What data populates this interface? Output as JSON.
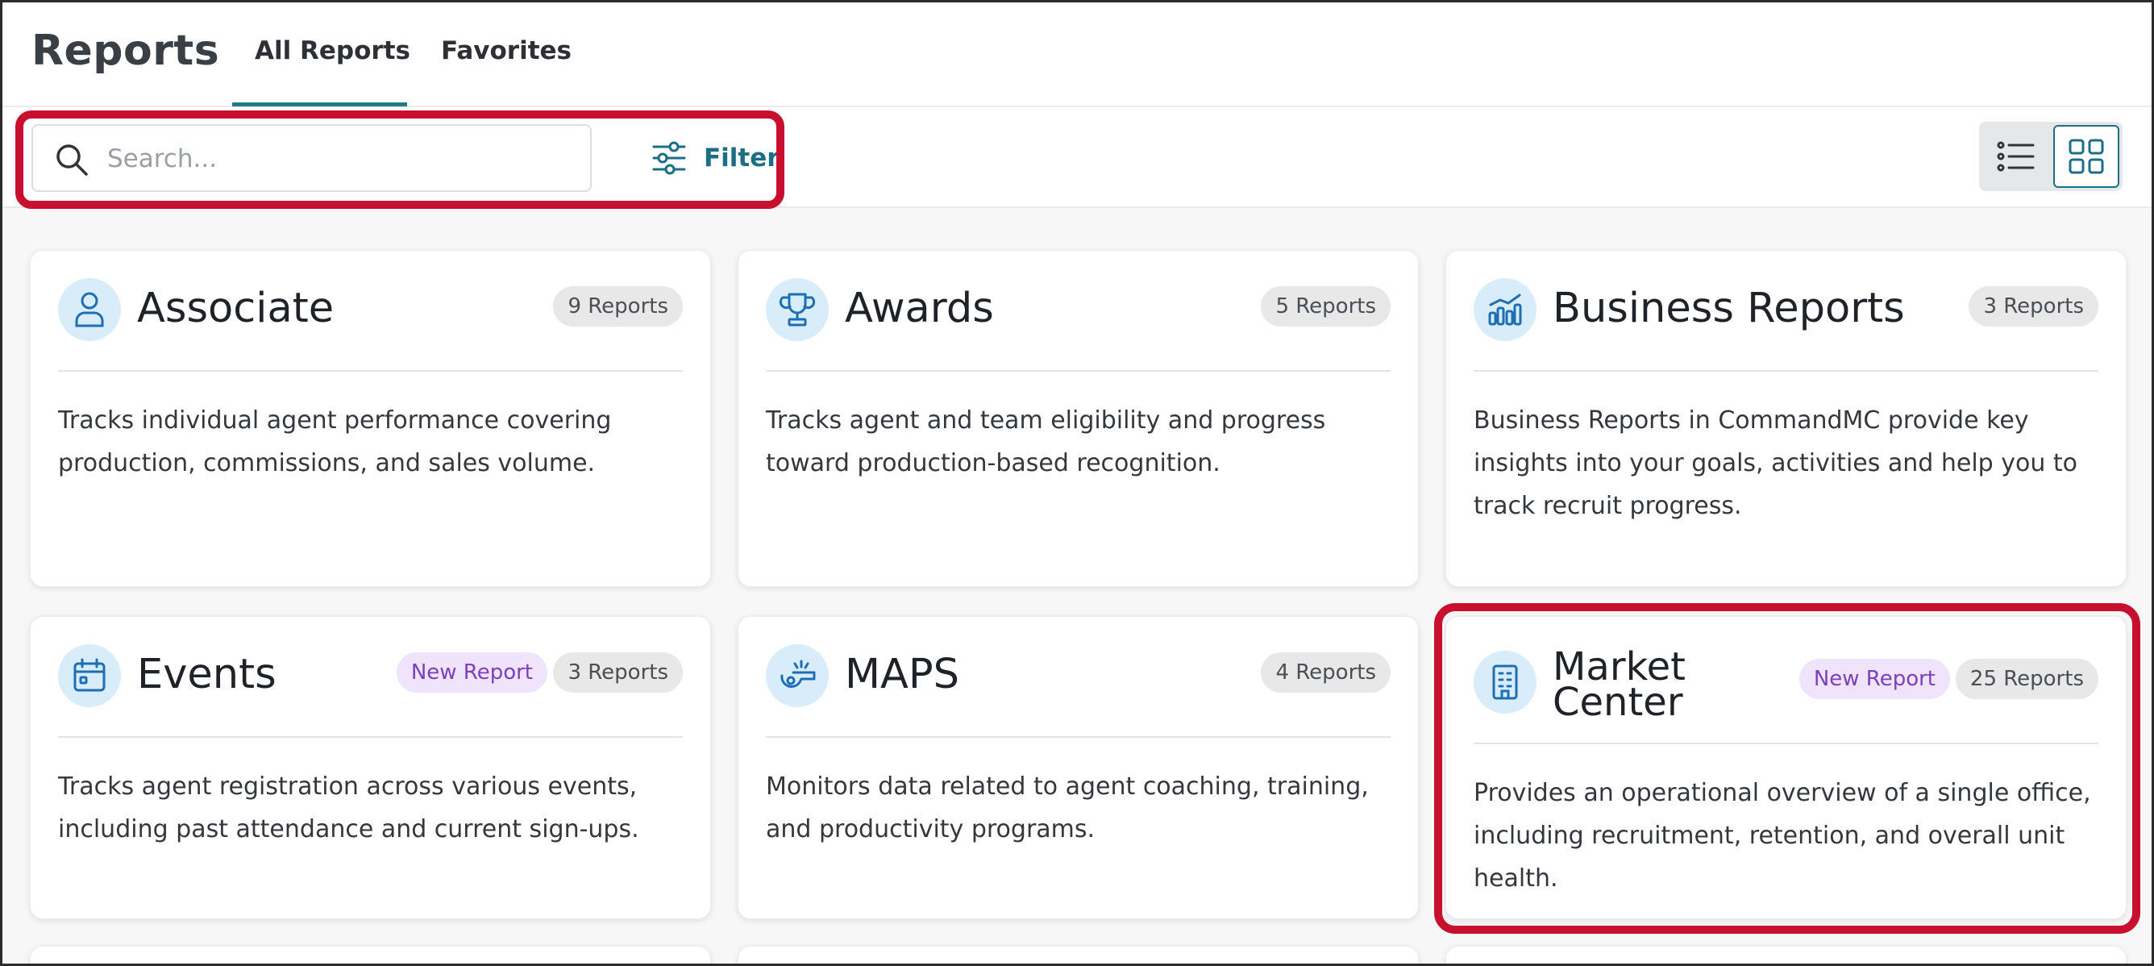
{
  "header": {
    "title": "Reports",
    "tabs": [
      {
        "label": "All Reports",
        "active": true
      },
      {
        "label": "Favorites",
        "active": false
      }
    ]
  },
  "toolbar": {
    "search_placeholder": "Search...",
    "filter_label": "Filter",
    "view_modes": [
      {
        "name": "list",
        "icon": "list-view-icon",
        "active": false
      },
      {
        "name": "grid",
        "icon": "grid-view-icon",
        "active": true
      }
    ]
  },
  "colors": {
    "accent": "#1a6f86",
    "highlight_box": "#c8102e",
    "icon_circle": "#d9ecfa",
    "icon_stroke": "#1c6fb5",
    "badge_new_bg": "#efe4fb",
    "badge_new_text": "#7b3fbf",
    "badge_count_bg": "#e8e8e8"
  },
  "cards": [
    {
      "title": "Associate",
      "icon": "person-icon",
      "count": "9 Reports",
      "new_badge": null,
      "description": "Tracks individual agent performance covering production, commissions, and sales volume."
    },
    {
      "title": "Awards",
      "icon": "trophy-icon",
      "count": "5 Reports",
      "new_badge": null,
      "description": "Tracks agent and team eligibility and progress toward production-based recognition."
    },
    {
      "title": "Business Reports",
      "icon": "bar-chart-icon",
      "count": "3 Reports",
      "new_badge": null,
      "description": "Business Reports in CommandMC provide key insights into your goals, activities and help you to track recruit progress."
    },
    {
      "title": "Events",
      "icon": "calendar-icon",
      "count": "3 Reports",
      "new_badge": "New Report",
      "description": "Tracks agent registration across various events, including past attendance and current sign-ups."
    },
    {
      "title": "MAPS",
      "icon": "whistle-icon",
      "count": "4 Reports",
      "new_badge": null,
      "description": "Monitors data related to agent coaching, training, and productivity programs."
    },
    {
      "title": "Market Center",
      "icon": "office-building-icon",
      "count": "25 Reports",
      "new_badge": "New Report",
      "description": "Provides an operational overview of a single office, including recruitment, retention, and overall unit health."
    }
  ]
}
